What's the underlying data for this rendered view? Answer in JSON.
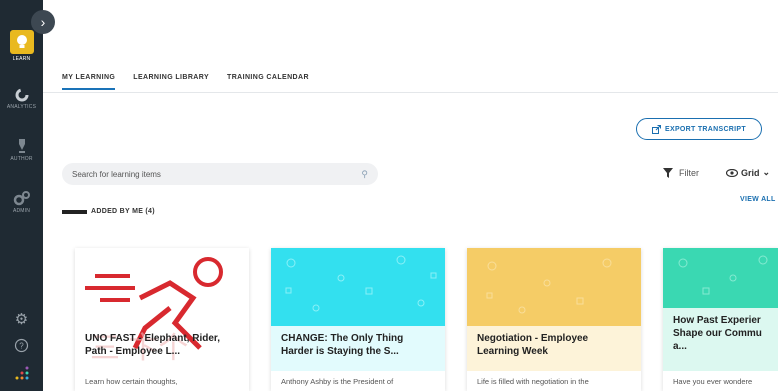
{
  "sidebar": {
    "items": [
      {
        "label": "LEARN",
        "icon": "lightbulb-icon",
        "active": true
      },
      {
        "label": "ANALYTICS",
        "icon": "analytics-icon"
      },
      {
        "label": "AUTHOR",
        "icon": "pen-icon"
      },
      {
        "label": "ADMIN",
        "icon": "gears-icon"
      }
    ],
    "bottom": [
      "settings-icon",
      "help-icon",
      "apps-icon"
    ],
    "accent": "#e9b91f"
  },
  "tabs": [
    "MY LEARNING",
    "LEARNING LIBRARY",
    "TRAINING CALENDAR"
  ],
  "export": {
    "label": "EXPORT TRANSCRIPT"
  },
  "search": {
    "placeholder": "Search for learning items"
  },
  "filter": {
    "label": "Filter"
  },
  "view": {
    "label": "Grid"
  },
  "section": {
    "title": "ADDED BY ME (4)",
    "view_all": "VIEW ALL"
  },
  "cards": [
    {
      "title": "UNO FAST - Elephant, Rider, Path - Employee L...",
      "desc": "Learn how certain thoughts,",
      "color": "#ffffff"
    },
    {
      "title": "CHANGE: The Only Thing Harder is Staying the S...",
      "desc": "Anthony Ashby is the President of",
      "color": "#33e0ef"
    },
    {
      "title": "Negotiation - Employee Learning Week",
      "desc": "Life is filled with negotiation in the",
      "color": "#f5cc66"
    },
    {
      "title": "How Past Experier Shape our Commu a...",
      "desc": "Have you ever wondere",
      "color": "#3ad8b2"
    }
  ]
}
